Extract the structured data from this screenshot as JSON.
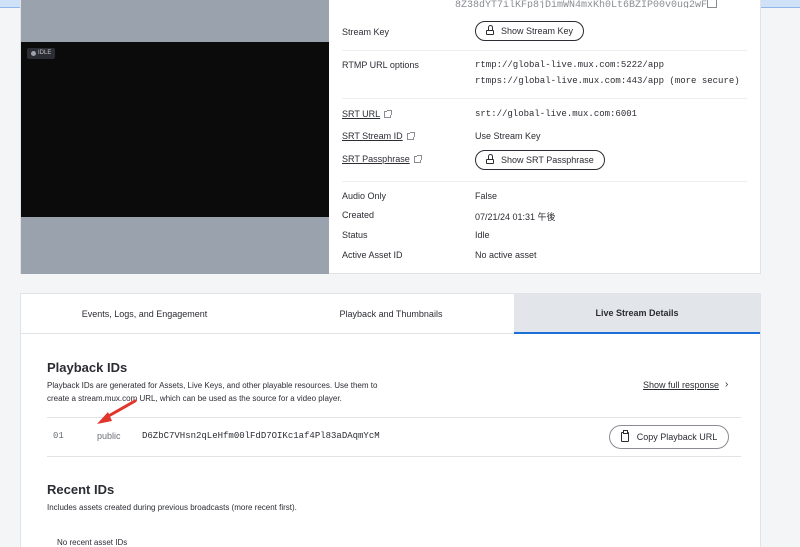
{
  "header": {
    "cut_off_value": "8Z38dYT7ilKFp8jDimWN4mxKh0Lt6BZIP00v0ug2wF"
  },
  "video": {
    "status_badge": "IDLE"
  },
  "details": {
    "stream_key": {
      "label": "Stream Key",
      "button": "Show Stream Key"
    },
    "rtmp": {
      "label": "RTMP URL options",
      "values": [
        "rtmp://global-live.mux.com:5222/app",
        "rtmps://global-live.mux.com:443/app (more secure)"
      ]
    },
    "srt_url": {
      "label": "SRT URL",
      "value": "srt://global-live.mux.com:6001"
    },
    "srt_stream_id": {
      "label": "SRT Stream ID",
      "value": "Use Stream Key"
    },
    "srt_passphrase": {
      "label": "SRT Passphrase",
      "button": "Show SRT Passphrase"
    },
    "audio_only": {
      "label": "Audio Only",
      "value": "False"
    },
    "created": {
      "label": "Created",
      "value": "07/21/24 01:31 午後"
    },
    "status": {
      "label": "Status",
      "value": "Idle"
    },
    "active_asset": {
      "label": "Active Asset ID",
      "value": "No active asset"
    }
  },
  "tabs": [
    {
      "label": "Events, Logs, and Engagement",
      "active": false
    },
    {
      "label": "Playback and Thumbnails",
      "active": false
    },
    {
      "label": "Live Stream Details",
      "active": true
    }
  ],
  "playback_ids": {
    "title": "Playback IDs",
    "description_line1": "Playback IDs are generated for Assets, Live Keys, and other playable resources. Use them to",
    "description_line2": "create a stream.mux.com URL, which can be used as the source for a video player.",
    "show_full": "Show full response",
    "chevron": "›",
    "rows": [
      {
        "num": "01",
        "policy": "public",
        "id": "D6ZbC7VHsn2qLeHfm00lFdD7OIKc1af4Pl83aDAqmYcM",
        "button": "Copy Playback URL"
      }
    ]
  },
  "recent_ids": {
    "title": "Recent IDs",
    "description": "Includes assets created during previous broadcasts (more recent first).",
    "empty": "No recent asset IDs"
  },
  "colors": {
    "accent": "#1b6fd8",
    "arrow": "#e0362c"
  }
}
